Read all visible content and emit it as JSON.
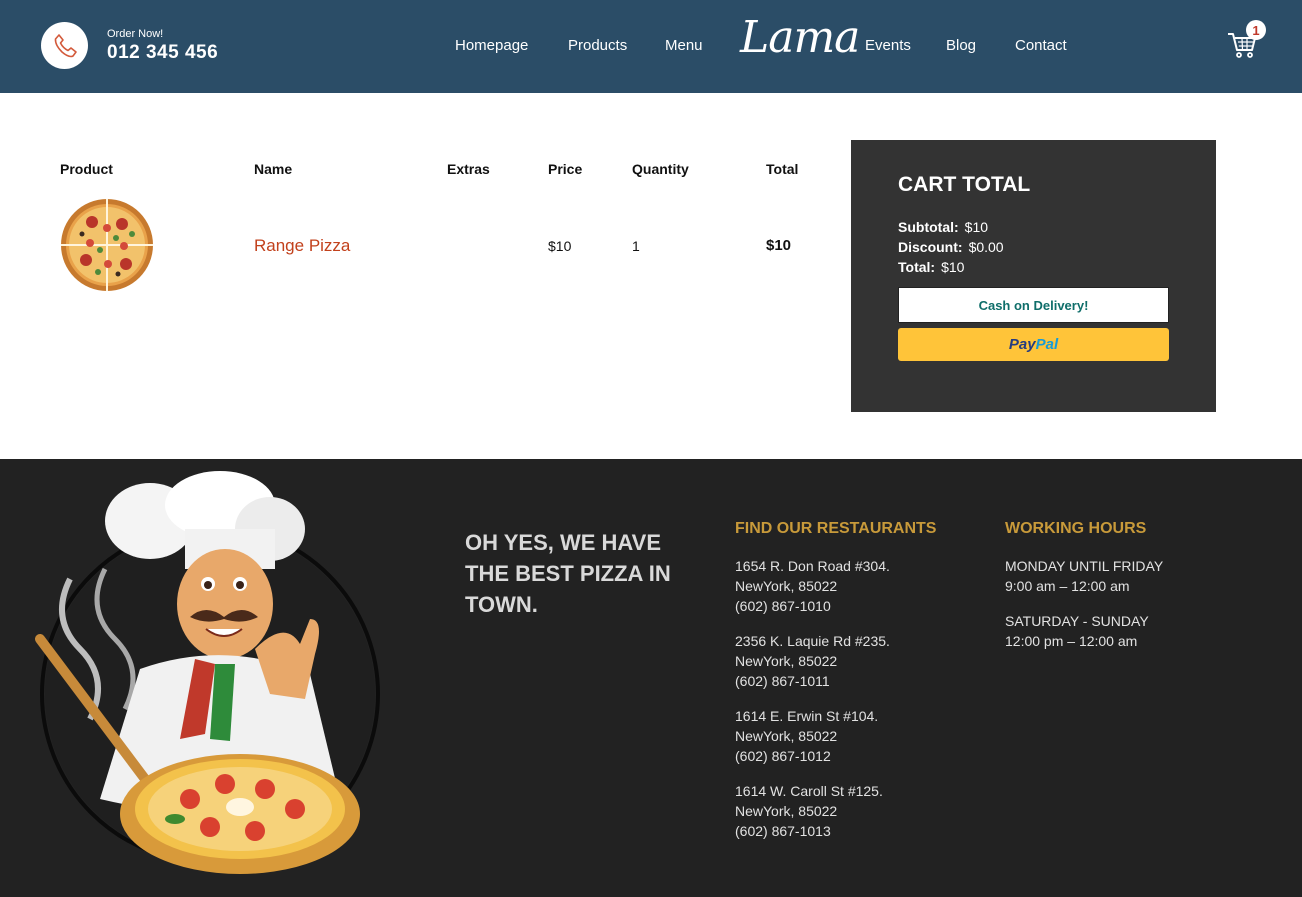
{
  "header": {
    "order_label": "Order Now!",
    "phone": "012 345 456",
    "nav": [
      "Homepage",
      "Products",
      "Menu",
      "Events",
      "Blog",
      "Contact"
    ],
    "logo": "Lama",
    "cart_count": "1"
  },
  "table": {
    "headers": [
      "Product",
      "Name",
      "Extras",
      "Price",
      "Quantity",
      "Total"
    ],
    "rows": [
      {
        "name": "Range Pizza",
        "extras": "",
        "price": "$10",
        "quantity": "1",
        "total": "$10"
      }
    ]
  },
  "cart_total": {
    "title": "CART TOTAL",
    "subtotal_label": "Subtotal:",
    "subtotal": "$10",
    "discount_label": "Discount:",
    "discount": "$0.00",
    "total_label": "Total:",
    "total": "$10",
    "cod_button": "Cash on Delivery!",
    "paypal_a": "Pay",
    "paypal_b": "Pal"
  },
  "footer": {
    "tagline": "OH YES, WE HAVE THE BEST PIZZA IN TOWN.",
    "restaurants_title": "FIND OUR RESTAURANTS",
    "restaurants": [
      {
        "line1": "1654 R. Don Road #304.",
        "line2": "NewYork, 85022",
        "line3": "(602) 867-1010"
      },
      {
        "line1": "2356 K. Laquie Rd #235.",
        "line2": "NewYork, 85022",
        "line3": "(602) 867-1011"
      },
      {
        "line1": "1614 E. Erwin St #104.",
        "line2": "NewYork, 85022",
        "line3": "(602) 867-1012"
      },
      {
        "line1": "1614 W. Caroll St #125.",
        "line2": "NewYork, 85022",
        "line3": "(602) 867-1013"
      }
    ],
    "hours_title": "WORKING HOURS",
    "hours": [
      {
        "days": "MONDAY UNTIL FRIDAY",
        "time": "9:00 am – 12:00 am"
      },
      {
        "days": "SATURDAY - SUNDAY",
        "time": "12:00 pm – 12:00 am"
      }
    ]
  },
  "colors": {
    "header_bg": "#2b4d67",
    "accent": "#c2411c",
    "footer_bg": "#222222",
    "footer_heading": "#c89a3a",
    "panel_bg": "#333333",
    "paypal": "#ffc439"
  }
}
